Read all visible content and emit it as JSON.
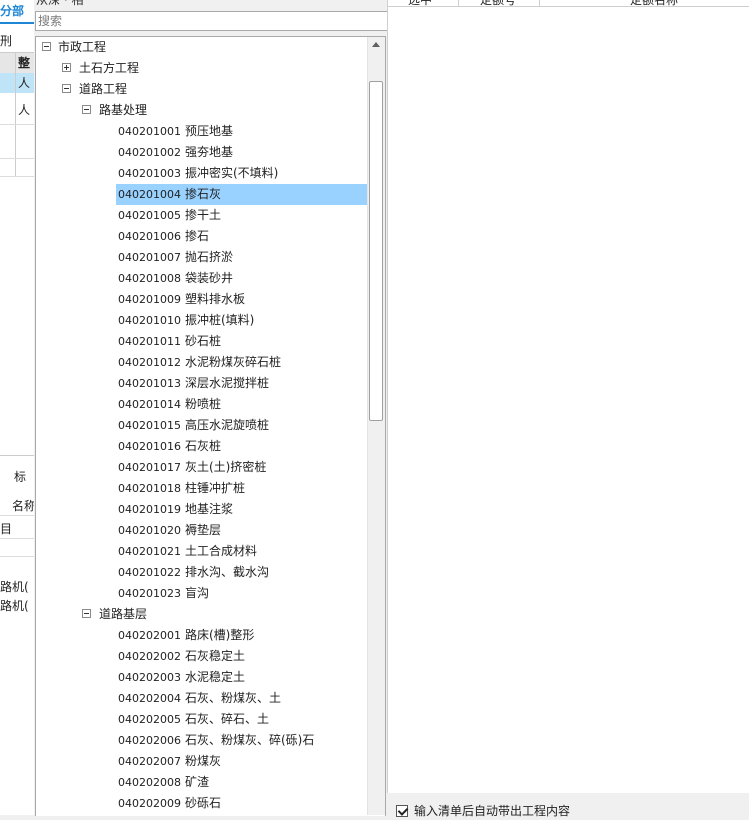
{
  "left_panel": {
    "tab_label": "分部",
    "header_text": "刑",
    "col_header": "整",
    "row1": "人",
    "row2": "人",
    "bottom_tab": "标",
    "bottom_col": "名称",
    "bottom_row": "目",
    "machine_row1": "路机(",
    "machine_row2": "路机("
  },
  "middle_top_label": "从深 · 相",
  "search": {
    "placeholder": "搜索"
  },
  "tree": {
    "root": "市政工程",
    "child1": "土石方工程",
    "child2": "道路工程",
    "group1": {
      "label": "路基处理",
      "items": [
        {
          "code": "040201001",
          "name": "预压地基"
        },
        {
          "code": "040201002",
          "name": "强夯地基"
        },
        {
          "code": "040201003",
          "name": "振冲密实(不填料)"
        },
        {
          "code": "040201004",
          "name": "掺石灰"
        },
        {
          "code": "040201005",
          "name": "掺干土"
        },
        {
          "code": "040201006",
          "name": "掺石"
        },
        {
          "code": "040201007",
          "name": "抛石挤淤"
        },
        {
          "code": "040201008",
          "name": "袋装砂井"
        },
        {
          "code": "040201009",
          "name": "塑料排水板"
        },
        {
          "code": "040201010",
          "name": "振冲桩(填料)"
        },
        {
          "code": "040201011",
          "name": "砂石桩"
        },
        {
          "code": "040201012",
          "name": "水泥粉煤灰碎石桩"
        },
        {
          "code": "040201013",
          "name": "深层水泥搅拌桩"
        },
        {
          "code": "040201014",
          "name": "粉喷桩"
        },
        {
          "code": "040201015",
          "name": "高压水泥旋喷桩"
        },
        {
          "code": "040201016",
          "name": "石灰桩"
        },
        {
          "code": "040201017",
          "name": "灰土(土)挤密桩"
        },
        {
          "code": "040201018",
          "name": "柱锤冲扩桩"
        },
        {
          "code": "040201019",
          "name": "地基注浆"
        },
        {
          "code": "040201020",
          "name": "褥垫层"
        },
        {
          "code": "040201021",
          "name": "土工合成材料"
        },
        {
          "code": "040201022",
          "name": "排水沟、截水沟"
        },
        {
          "code": "040201023",
          "name": "盲沟"
        }
      ]
    },
    "group2": {
      "label": "道路基层",
      "items": [
        {
          "code": "040202001",
          "name": "路床(槽)整形"
        },
        {
          "code": "040202002",
          "name": "石灰稳定土"
        },
        {
          "code": "040202003",
          "name": "水泥稳定土"
        },
        {
          "code": "040202004",
          "name": "石灰、粉煤灰、土"
        },
        {
          "code": "040202005",
          "name": "石灰、碎石、土"
        },
        {
          "code": "040202006",
          "name": "石灰、粉煤灰、碎(砾)石"
        },
        {
          "code": "040202007",
          "name": "粉煤灰"
        },
        {
          "code": "040202008",
          "name": "矿渣"
        },
        {
          "code": "040202009",
          "name": "砂砾石"
        }
      ]
    },
    "selected_code": "040201004"
  },
  "right_panel": {
    "col1": "选中",
    "col2": "定额号",
    "col3": "定额名称"
  },
  "auto_check": {
    "checked": true,
    "label": "输入清单后自动带出工程内容"
  },
  "colors": {
    "selection": "#99d1ff",
    "tab_accent": "#1e86d6"
  }
}
